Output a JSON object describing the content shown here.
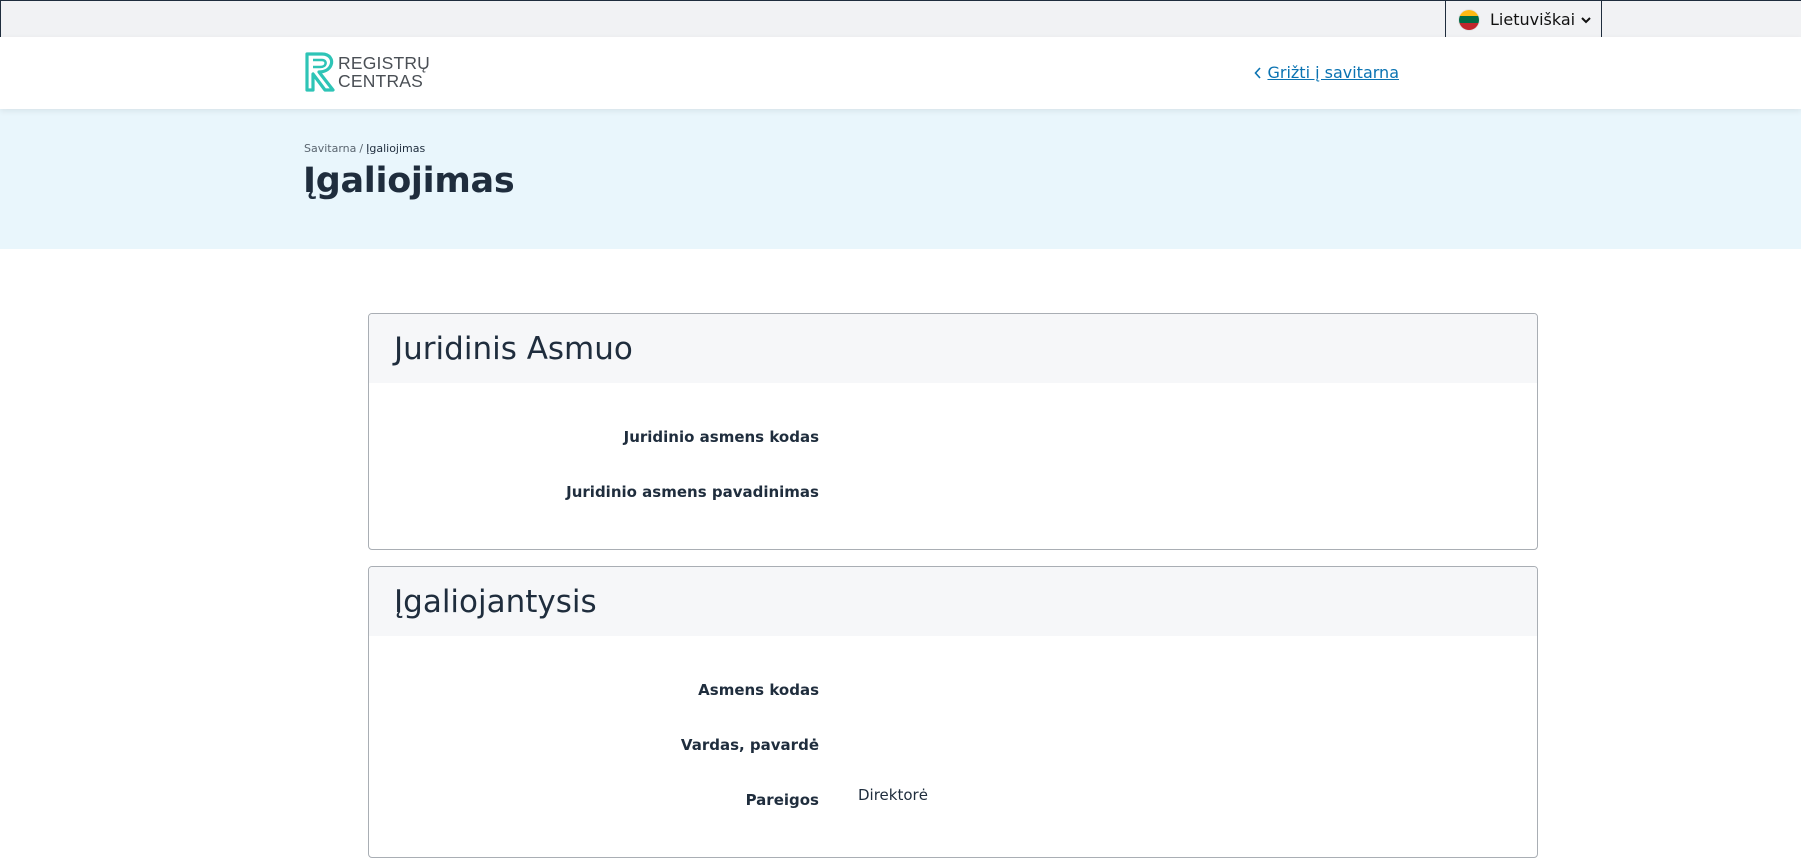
{
  "language": {
    "selected": "Lietuviškai"
  },
  "header": {
    "logo_line1": "REGISTRŲ",
    "logo_line2": "CENTRAS",
    "back_link": "Grižti į savitarna"
  },
  "breadcrumb": {
    "root": "Savitarna",
    "separator": "/",
    "current": "Įgaliojimas"
  },
  "page_title": "Įgaliojimas",
  "sections": [
    {
      "title": "Juridinis Asmuo",
      "rows": [
        {
          "label": "Juridinio asmens kodas",
          "value": ""
        },
        {
          "label": "Juridinio asmens pavadinimas",
          "value": ""
        }
      ]
    },
    {
      "title": "Įgaliojantysis",
      "rows": [
        {
          "label": "Asmens kodas",
          "value": ""
        },
        {
          "label": "Vardas, pavardė",
          "value": ""
        },
        {
          "label": "Pareigos",
          "value": "Direktorė"
        }
      ]
    }
  ],
  "colors": {
    "accent_link": "#0a73b2",
    "hero_background": "#e9f6fc",
    "logo_teal": "#2ec4b6"
  },
  "icons": {
    "flag": "lithuania-flag-icon",
    "dropdown": "chevron-down-icon",
    "back": "chevron-left-icon"
  }
}
